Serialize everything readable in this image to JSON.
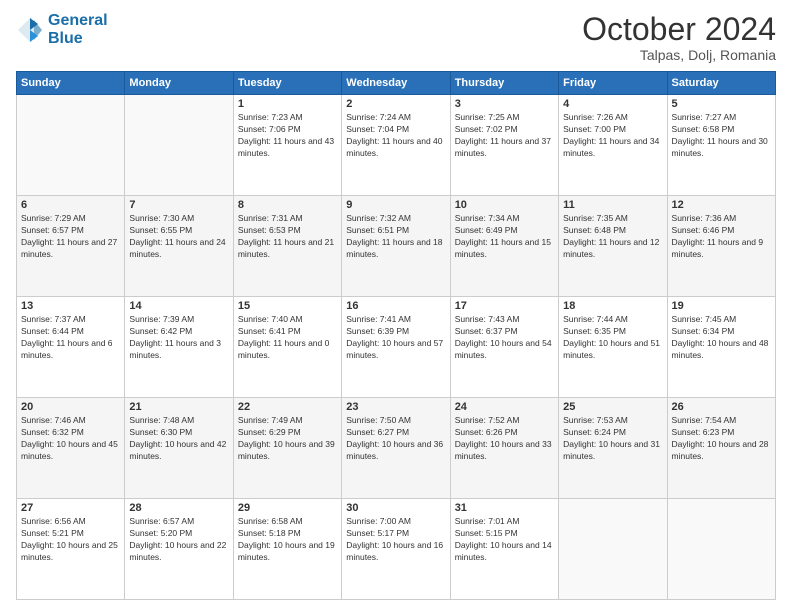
{
  "header": {
    "logo_line1": "General",
    "logo_line2": "Blue",
    "month_year": "October 2024",
    "location": "Talpas, Dolj, Romania"
  },
  "days_of_week": [
    "Sunday",
    "Monday",
    "Tuesday",
    "Wednesday",
    "Thursday",
    "Friday",
    "Saturday"
  ],
  "weeks": [
    [
      {
        "day": "",
        "sunrise": "",
        "sunset": "",
        "daylight": ""
      },
      {
        "day": "",
        "sunrise": "",
        "sunset": "",
        "daylight": ""
      },
      {
        "day": "1",
        "sunrise": "Sunrise: 7:23 AM",
        "sunset": "Sunset: 7:06 PM",
        "daylight": "Daylight: 11 hours and 43 minutes."
      },
      {
        "day": "2",
        "sunrise": "Sunrise: 7:24 AM",
        "sunset": "Sunset: 7:04 PM",
        "daylight": "Daylight: 11 hours and 40 minutes."
      },
      {
        "day": "3",
        "sunrise": "Sunrise: 7:25 AM",
        "sunset": "Sunset: 7:02 PM",
        "daylight": "Daylight: 11 hours and 37 minutes."
      },
      {
        "day": "4",
        "sunrise": "Sunrise: 7:26 AM",
        "sunset": "Sunset: 7:00 PM",
        "daylight": "Daylight: 11 hours and 34 minutes."
      },
      {
        "day": "5",
        "sunrise": "Sunrise: 7:27 AM",
        "sunset": "Sunset: 6:58 PM",
        "daylight": "Daylight: 11 hours and 30 minutes."
      }
    ],
    [
      {
        "day": "6",
        "sunrise": "Sunrise: 7:29 AM",
        "sunset": "Sunset: 6:57 PM",
        "daylight": "Daylight: 11 hours and 27 minutes."
      },
      {
        "day": "7",
        "sunrise": "Sunrise: 7:30 AM",
        "sunset": "Sunset: 6:55 PM",
        "daylight": "Daylight: 11 hours and 24 minutes."
      },
      {
        "day": "8",
        "sunrise": "Sunrise: 7:31 AM",
        "sunset": "Sunset: 6:53 PM",
        "daylight": "Daylight: 11 hours and 21 minutes."
      },
      {
        "day": "9",
        "sunrise": "Sunrise: 7:32 AM",
        "sunset": "Sunset: 6:51 PM",
        "daylight": "Daylight: 11 hours and 18 minutes."
      },
      {
        "day": "10",
        "sunrise": "Sunrise: 7:34 AM",
        "sunset": "Sunset: 6:49 PM",
        "daylight": "Daylight: 11 hours and 15 minutes."
      },
      {
        "day": "11",
        "sunrise": "Sunrise: 7:35 AM",
        "sunset": "Sunset: 6:48 PM",
        "daylight": "Daylight: 11 hours and 12 minutes."
      },
      {
        "day": "12",
        "sunrise": "Sunrise: 7:36 AM",
        "sunset": "Sunset: 6:46 PM",
        "daylight": "Daylight: 11 hours and 9 minutes."
      }
    ],
    [
      {
        "day": "13",
        "sunrise": "Sunrise: 7:37 AM",
        "sunset": "Sunset: 6:44 PM",
        "daylight": "Daylight: 11 hours and 6 minutes."
      },
      {
        "day": "14",
        "sunrise": "Sunrise: 7:39 AM",
        "sunset": "Sunset: 6:42 PM",
        "daylight": "Daylight: 11 hours and 3 minutes."
      },
      {
        "day": "15",
        "sunrise": "Sunrise: 7:40 AM",
        "sunset": "Sunset: 6:41 PM",
        "daylight": "Daylight: 11 hours and 0 minutes."
      },
      {
        "day": "16",
        "sunrise": "Sunrise: 7:41 AM",
        "sunset": "Sunset: 6:39 PM",
        "daylight": "Daylight: 10 hours and 57 minutes."
      },
      {
        "day": "17",
        "sunrise": "Sunrise: 7:43 AM",
        "sunset": "Sunset: 6:37 PM",
        "daylight": "Daylight: 10 hours and 54 minutes."
      },
      {
        "day": "18",
        "sunrise": "Sunrise: 7:44 AM",
        "sunset": "Sunset: 6:35 PM",
        "daylight": "Daylight: 10 hours and 51 minutes."
      },
      {
        "day": "19",
        "sunrise": "Sunrise: 7:45 AM",
        "sunset": "Sunset: 6:34 PM",
        "daylight": "Daylight: 10 hours and 48 minutes."
      }
    ],
    [
      {
        "day": "20",
        "sunrise": "Sunrise: 7:46 AM",
        "sunset": "Sunset: 6:32 PM",
        "daylight": "Daylight: 10 hours and 45 minutes."
      },
      {
        "day": "21",
        "sunrise": "Sunrise: 7:48 AM",
        "sunset": "Sunset: 6:30 PM",
        "daylight": "Daylight: 10 hours and 42 minutes."
      },
      {
        "day": "22",
        "sunrise": "Sunrise: 7:49 AM",
        "sunset": "Sunset: 6:29 PM",
        "daylight": "Daylight: 10 hours and 39 minutes."
      },
      {
        "day": "23",
        "sunrise": "Sunrise: 7:50 AM",
        "sunset": "Sunset: 6:27 PM",
        "daylight": "Daylight: 10 hours and 36 minutes."
      },
      {
        "day": "24",
        "sunrise": "Sunrise: 7:52 AM",
        "sunset": "Sunset: 6:26 PM",
        "daylight": "Daylight: 10 hours and 33 minutes."
      },
      {
        "day": "25",
        "sunrise": "Sunrise: 7:53 AM",
        "sunset": "Sunset: 6:24 PM",
        "daylight": "Daylight: 10 hours and 31 minutes."
      },
      {
        "day": "26",
        "sunrise": "Sunrise: 7:54 AM",
        "sunset": "Sunset: 6:23 PM",
        "daylight": "Daylight: 10 hours and 28 minutes."
      }
    ],
    [
      {
        "day": "27",
        "sunrise": "Sunrise: 6:56 AM",
        "sunset": "Sunset: 5:21 PM",
        "daylight": "Daylight: 10 hours and 25 minutes."
      },
      {
        "day": "28",
        "sunrise": "Sunrise: 6:57 AM",
        "sunset": "Sunset: 5:20 PM",
        "daylight": "Daylight: 10 hours and 22 minutes."
      },
      {
        "day": "29",
        "sunrise": "Sunrise: 6:58 AM",
        "sunset": "Sunset: 5:18 PM",
        "daylight": "Daylight: 10 hours and 19 minutes."
      },
      {
        "day": "30",
        "sunrise": "Sunrise: 7:00 AM",
        "sunset": "Sunset: 5:17 PM",
        "daylight": "Daylight: 10 hours and 16 minutes."
      },
      {
        "day": "31",
        "sunrise": "Sunrise: 7:01 AM",
        "sunset": "Sunset: 5:15 PM",
        "daylight": "Daylight: 10 hours and 14 minutes."
      },
      {
        "day": "",
        "sunrise": "",
        "sunset": "",
        "daylight": ""
      },
      {
        "day": "",
        "sunrise": "",
        "sunset": "",
        "daylight": ""
      }
    ]
  ]
}
